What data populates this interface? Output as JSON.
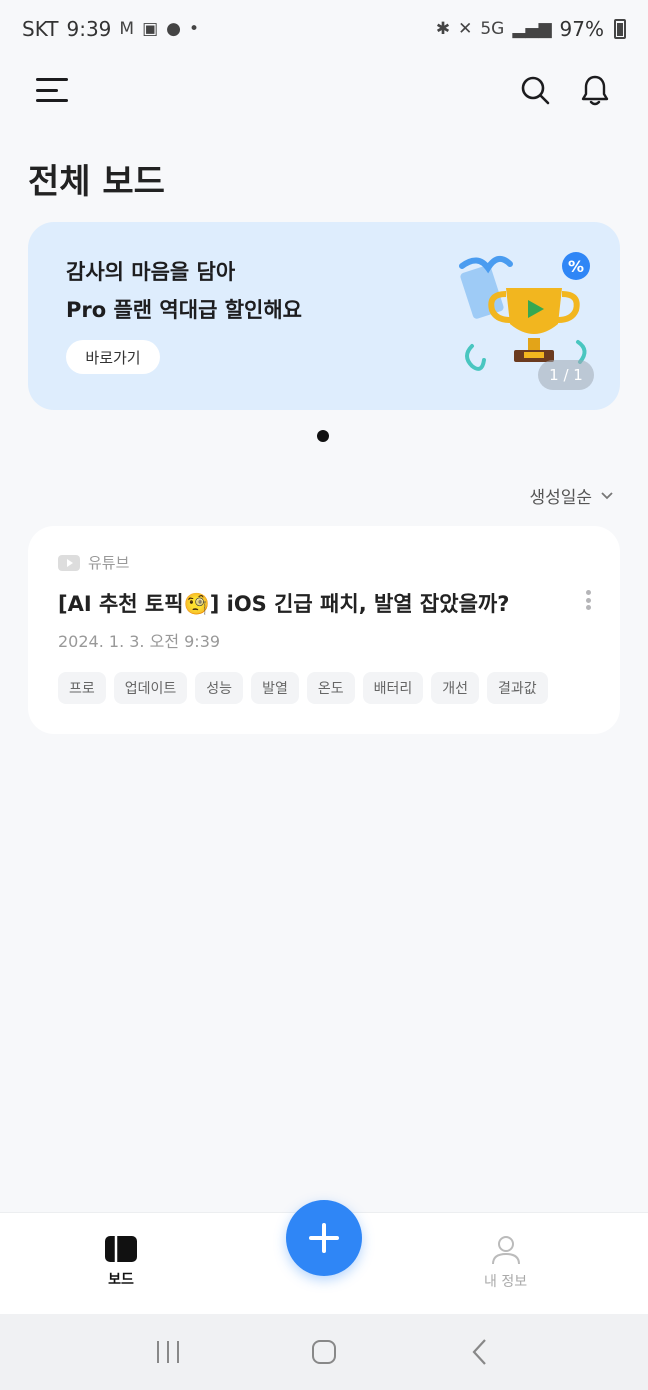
{
  "status_bar": {
    "carrier": "SKT",
    "time": "9:39",
    "battery": "97%",
    "network": "5G"
  },
  "header": {
    "title": "전체 보드"
  },
  "banner": {
    "line1": "감사의 마음을 담아",
    "line2": "Pro 플랜 역대급 할인해요",
    "button_label": "바로가기",
    "counter": "1 / 1"
  },
  "sort": {
    "label": "생성일순"
  },
  "card": {
    "source": "유튜브",
    "title": "[AI 추천 토픽🧐] iOS 긴급 패치, 발열 잡았을까?",
    "date": "2024. 1. 3. 오전 9:39",
    "tags": [
      "프로",
      "업데이트",
      "성능",
      "발열",
      "온도",
      "배터리",
      "개선",
      "결과값"
    ]
  },
  "bottom_nav": {
    "board_label": "보드",
    "my_label": "내 정보"
  },
  "colors": {
    "accent": "#2f86f6",
    "banner_bg": "#deedfd"
  }
}
